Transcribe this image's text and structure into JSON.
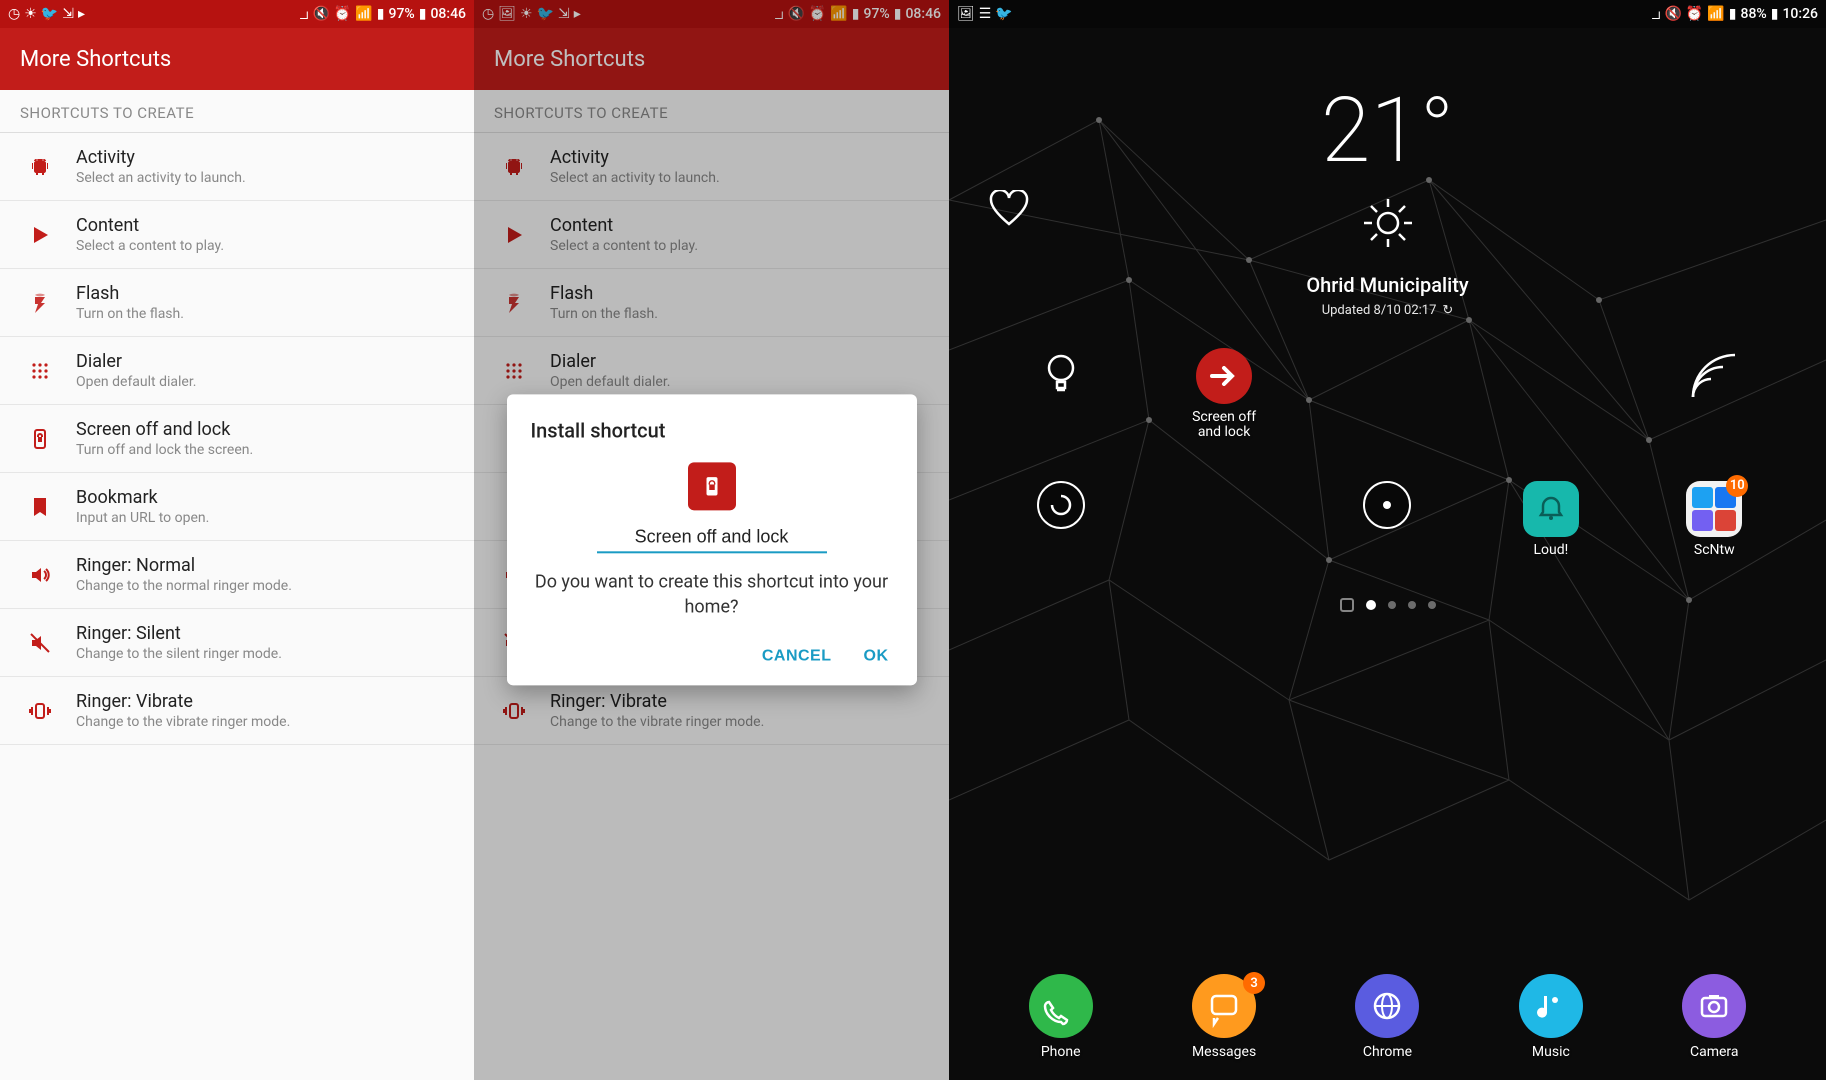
{
  "panel1": {
    "statusbar": {
      "network_pct": "97%",
      "time": "08:46"
    },
    "title": "More Shortcuts",
    "section_header": "SHORTCUTS TO CREATE",
    "items": [
      {
        "icon": "android",
        "title": "Activity",
        "sub": "Select an activity to launch."
      },
      {
        "icon": "play",
        "title": "Content",
        "sub": "Select a content to play."
      },
      {
        "icon": "flash",
        "title": "Flash",
        "sub": "Turn on the flash."
      },
      {
        "icon": "dialer",
        "title": "Dialer",
        "sub": "Open default dialer."
      },
      {
        "icon": "lock",
        "title": "Screen off and lock",
        "sub": "Turn off and lock the screen."
      },
      {
        "icon": "bookmark",
        "title": "Bookmark",
        "sub": "Input an URL to open."
      },
      {
        "icon": "volume",
        "title": "Ringer: Normal",
        "sub": "Change to the normal ringer mode."
      },
      {
        "icon": "mute",
        "title": "Ringer: Silent",
        "sub": "Change to the silent ringer mode."
      },
      {
        "icon": "vibrate",
        "title": "Ringer: Vibrate",
        "sub": "Change to the vibrate ringer mode."
      }
    ]
  },
  "panel2": {
    "statusbar": {
      "network_pct": "97%",
      "time": "08:46"
    },
    "title": "More Shortcuts",
    "section_header": "SHORTCUTS TO CREATE",
    "dialog": {
      "title": "Install shortcut",
      "input_value": "Screen off and lock",
      "message": "Do you want to create this shortcut into your home?",
      "cancel": "CANCEL",
      "ok": "OK"
    }
  },
  "panel3": {
    "statusbar": {
      "network_pct": "88%",
      "time": "10:26"
    },
    "weather": {
      "temp": "21°",
      "location": "Ohrid Municipality",
      "updated": "Updated 8/10 02:17"
    },
    "row1": [
      {
        "type": "outline-bulb",
        "label": ""
      },
      {
        "type": "red-arrow",
        "label": "Screen off and lock"
      },
      {
        "type": "spacer",
        "label": ""
      },
      {
        "type": "spacer",
        "label": ""
      },
      {
        "type": "outline-arc",
        "label": ""
      }
    ],
    "row2": [
      {
        "type": "outline-swirl",
        "label": ""
      },
      {
        "type": "spacer",
        "label": ""
      },
      {
        "type": "outline-circle",
        "label": ""
      },
      {
        "type": "teal-bell",
        "label": "Loud!"
      },
      {
        "type": "folder",
        "label": "ScNtw",
        "badge": "10"
      }
    ],
    "dock": [
      {
        "color": "#2FB84A",
        "icon": "phone",
        "label": "Phone"
      },
      {
        "color": "#FF9A1E",
        "icon": "msg",
        "label": "Messages",
        "badge": "3"
      },
      {
        "color": "#5A5CE0",
        "icon": "globe",
        "label": "Chrome"
      },
      {
        "color": "#1FB8E6",
        "icon": "music",
        "label": "Music"
      },
      {
        "color": "#8C5CE0",
        "icon": "camera",
        "label": "Camera"
      }
    ]
  }
}
